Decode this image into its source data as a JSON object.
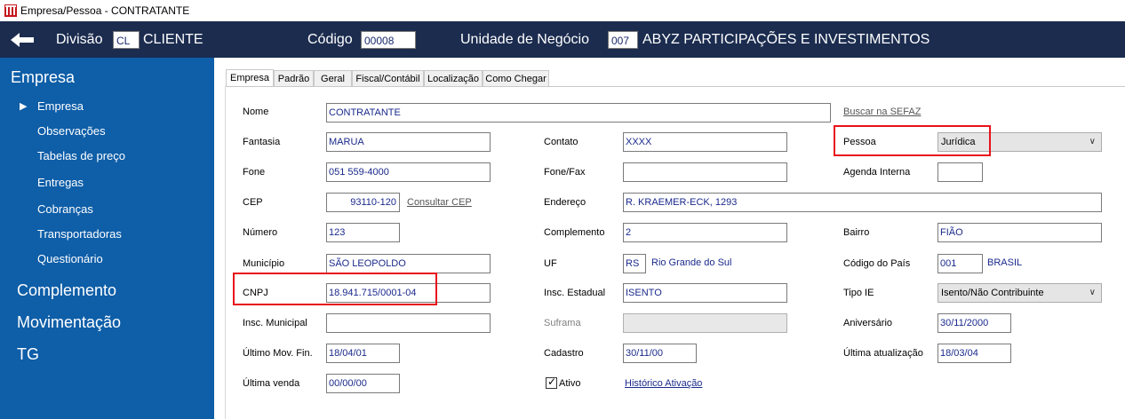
{
  "window": {
    "title": "Empresa/Pessoa - CONTRATANTE"
  },
  "header": {
    "back_icon": "arrow-left-icon",
    "divisao_label": "Divisão",
    "divisao_code": "CL",
    "divisao_name": "CLIENTE",
    "codigo_label": "Código",
    "codigo_value": "00008",
    "unidade_label": "Unidade de Negócio",
    "unidade_code": "007",
    "unidade_name": "ABYZ PARTICIPAÇÕES E INVESTIMENTOS"
  },
  "sidebar": {
    "section_empresa": "Empresa",
    "items": [
      "Empresa",
      "Observações",
      "Tabelas de preço",
      "Entregas",
      "Cobranças",
      "Transportadoras",
      "Questionário"
    ],
    "section_complemento": "Complemento",
    "section_movimentacao": "Movimentação",
    "section_tg": "TG"
  },
  "tabs": [
    "Empresa",
    "Padrão",
    "Geral",
    "Fiscal/Contábil",
    "Localização",
    "Como Chegar"
  ],
  "form": {
    "nome": {
      "label": "Nome",
      "value": "CONTRATANTE"
    },
    "buscar_sefaz": "Buscar na SEFAZ",
    "fantasia": {
      "label": "Fantasia",
      "value": "MARUA"
    },
    "contato": {
      "label": "Contato",
      "value": "XXXX"
    },
    "pessoa": {
      "label": "Pessoa",
      "value": "Jurídica"
    },
    "fone": {
      "label": "Fone",
      "value": "051 559-4000"
    },
    "fone_fax": {
      "label": "Fone/Fax",
      "value": ""
    },
    "agenda_interna": {
      "label": "Agenda Interna",
      "value": ""
    },
    "cep": {
      "label": "CEP",
      "value": "93110-120"
    },
    "consultar_cep": "Consultar CEP",
    "endereco": {
      "label": "Endereço",
      "value": "R. KRAEMER-ECK, 1293"
    },
    "numero": {
      "label": "Número",
      "value": "123"
    },
    "complemento": {
      "label": "Complemento",
      "value": "2"
    },
    "bairro": {
      "label": "Bairro",
      "value": "FIÃO"
    },
    "municipio": {
      "label": "Município",
      "value": "SÃO LEOPOLDO"
    },
    "uf": {
      "label": "UF",
      "value": "RS",
      "name": "Rio Grande do Sul"
    },
    "codigo_pais": {
      "label": "Código do País",
      "value": "001",
      "name": "BRASIL"
    },
    "cnpj": {
      "label": "CNPJ",
      "value": "18.941.715/0001-04"
    },
    "insc_estadual": {
      "label": "Insc. Estadual",
      "value": "ISENTO"
    },
    "tipo_ie": {
      "label": "Tipo IE",
      "value": "Isento/Não Contribuinte"
    },
    "insc_municipal": {
      "label": "Insc. Municipal",
      "value": ""
    },
    "suframa": {
      "label": "Suframa",
      "value": ""
    },
    "aniversario": {
      "label": "Aniversário",
      "value": "30/11/2000"
    },
    "ultimo_mov_fin": {
      "label": "Último Mov. Fin.",
      "value": "18/04/01"
    },
    "cadastro": {
      "label": "Cadastro",
      "value": "30/11/00"
    },
    "ultima_atualizacao": {
      "label": "Última atualização",
      "value": "18/03/04"
    },
    "ultima_venda": {
      "label": "Última venda",
      "value": "00/00/00"
    },
    "ativo": {
      "label": "Ativo",
      "checked": true
    },
    "historico_ativacao": "Histórico Ativação"
  },
  "colors": {
    "header_bg": "#1b2c4f",
    "sidebar_bg": "#0e5ea8",
    "highlight": "#e8111a",
    "field_text": "#1a2a8c"
  }
}
